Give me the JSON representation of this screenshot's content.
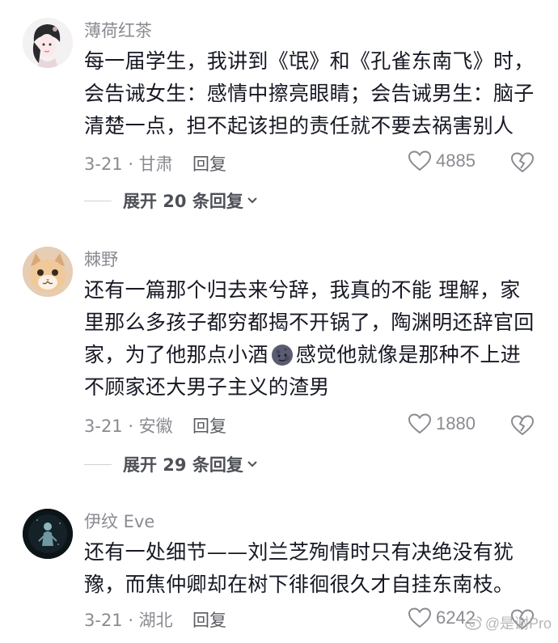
{
  "comments": [
    {
      "username": "薄荷红茶",
      "text_lines": [
        "每一届学生，我讲到《氓》和《孔雀东南飞》时，",
        "会告诫女生：感情中擦亮眼睛；会告诫男生：脑子",
        "清楚一点，担不起该担的责任就不要去祸害别人"
      ],
      "meta": "3-21 · 甘肃",
      "reply_label": "回复",
      "likes": "4885",
      "expand_label": "展开 20 条回复",
      "avatar_icon": "girl-portrait-avatar"
    },
    {
      "username": "棘野",
      "text_lines": [
        "还有一篇那个归去来兮辞，我真的不能 理解，家",
        "里那么多孩子都穷都揭不开锅了，陶渊明还辞官回",
        "家，为了他那点小酒",
        "不顾家还大男子主义的渣男"
      ],
      "line3_after_emoji": "感觉他就像是那种不上进",
      "meta": "3-21 · 安徽",
      "reply_label": "回复",
      "likes": "1880",
      "expand_label": "展开 29 条回复",
      "avatar_icon": "cat-avatar",
      "emoji_icon": "moon-face-emoji"
    },
    {
      "username": "伊纹 Eve",
      "text_lines": [
        "还有一处细节——刘兰芝殉情时只有决绝没有犹",
        "豫，而焦仲卿却在树下徘徊很久才自挂东南枝。"
      ],
      "meta": "3-21 · 湖北",
      "reply_label": "回复",
      "likes": "6242",
      "avatar_icon": "dark-figure-avatar"
    }
  ],
  "watermark": "@是谢Pro",
  "colors": {
    "text": "#161823",
    "secondary": "#8a8b91"
  }
}
